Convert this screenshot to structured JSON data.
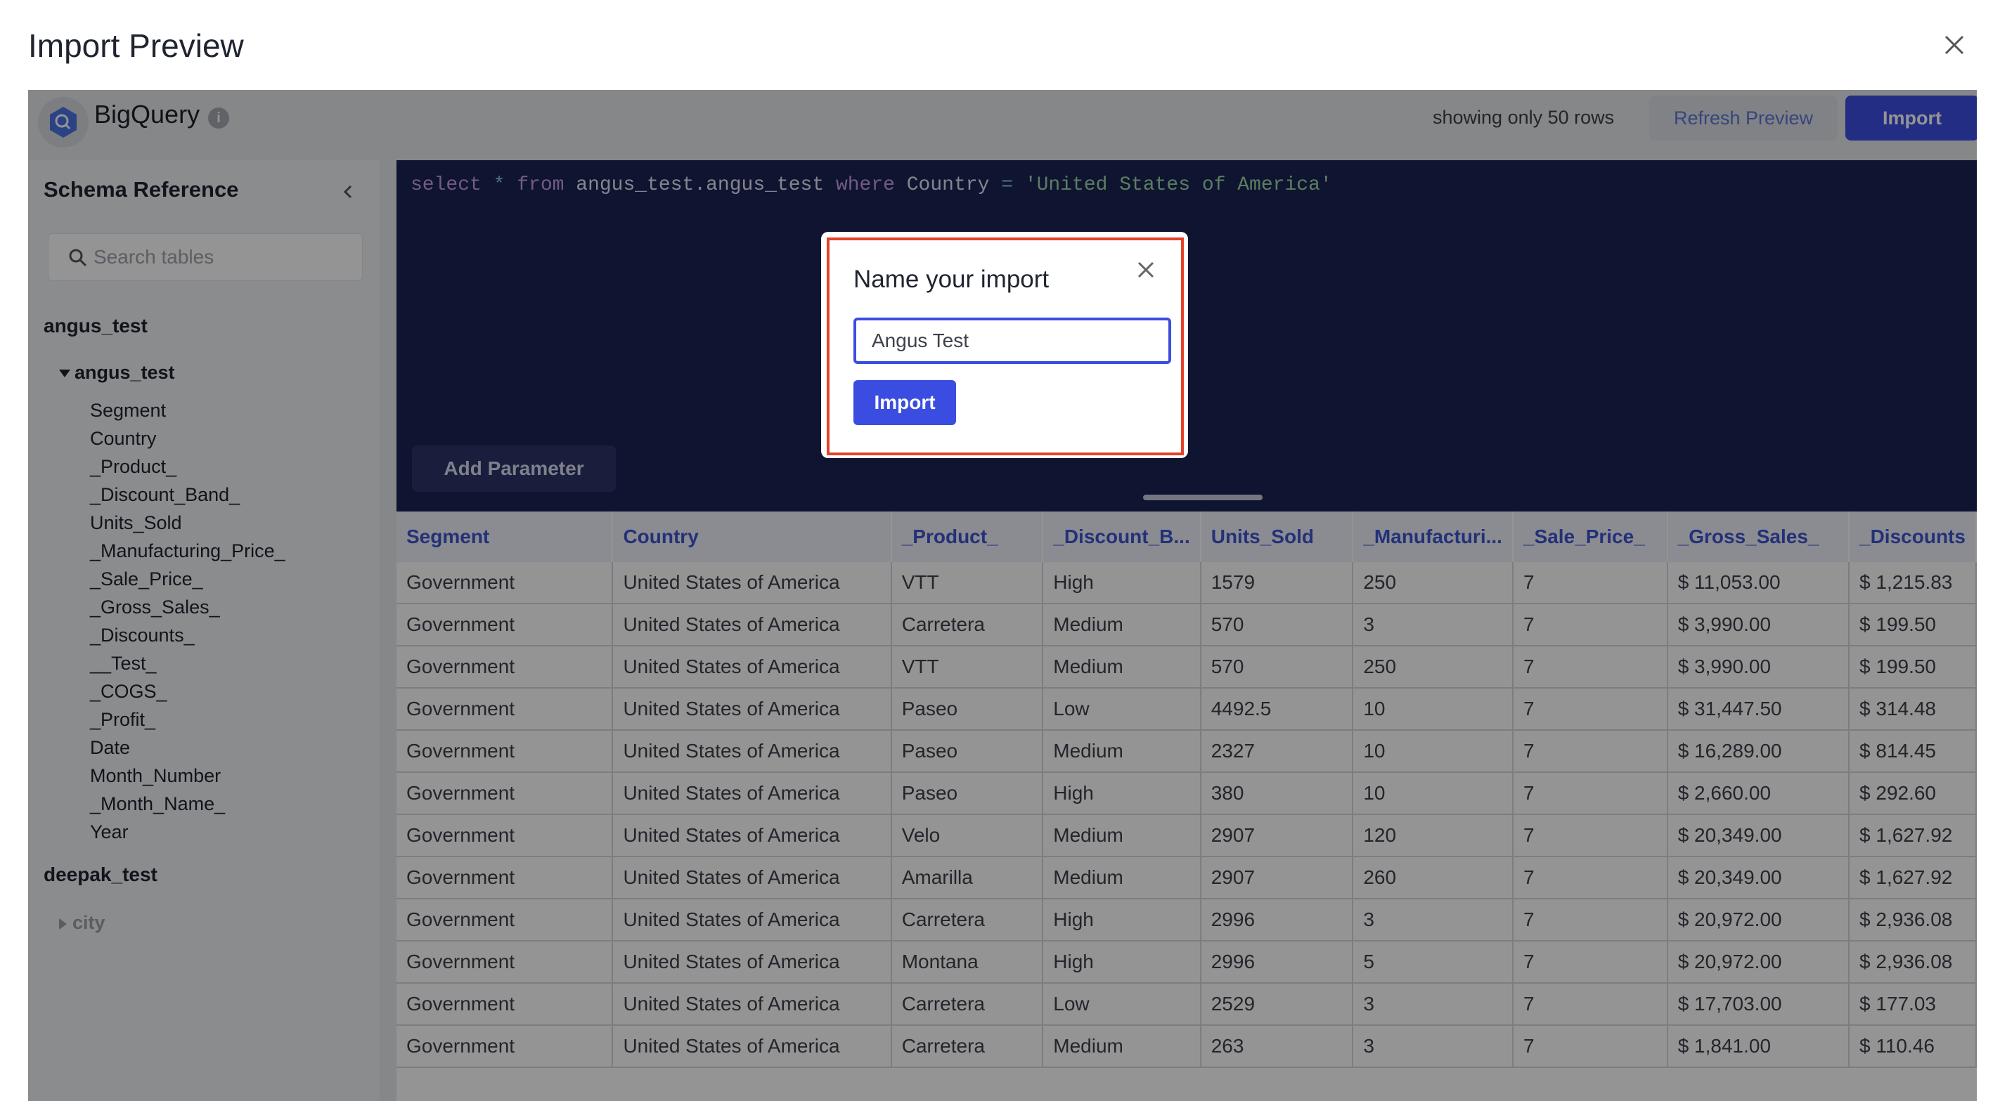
{
  "dialog": {
    "title": "Import Preview"
  },
  "toolbar": {
    "source_name": "BigQuery",
    "info_icon": "i",
    "rows_note": "showing only 50 rows",
    "refresh_label": "Refresh Preview",
    "import_label": "Import"
  },
  "sidebar": {
    "title": "Schema Reference",
    "search_placeholder": "Search tables",
    "databases": [
      {
        "name": "angus_test",
        "table": "angus_test",
        "columns": [
          "Segment",
          "Country",
          "_Product_",
          "_Discount_Band_",
          "Units_Sold",
          "_Manufacturing_Price_",
          "_Sale_Price_",
          "_Gross_Sales_",
          "_Discounts_",
          "__Test_",
          "_COGS_",
          "_Profit_",
          "Date",
          "Month_Number",
          "_Month_Name_",
          "Year"
        ]
      },
      {
        "name": "deepak_test",
        "table": "city"
      }
    ]
  },
  "editor": {
    "sql": {
      "kw1": "select",
      "star": " * ",
      "kw2": "from",
      "table": " angus_test.angus_test ",
      "kw3": "where",
      "col": " Country ",
      "eq": "=",
      "value": " 'United States of America'"
    },
    "add_parameter_label": "Add Parameter"
  },
  "table": {
    "headers": [
      "Segment",
      "Country",
      "_Product_",
      "_Discount_B...",
      "Units_Sold",
      "_Manufacturi...",
      "_Sale_Price_",
      "_Gross_Sales_",
      "_Discounts"
    ],
    "rows": [
      [
        "Government",
        "United States of America",
        "VTT",
        "High",
        "1579",
        "250",
        "7",
        "$ 11,053.00",
        "$ 1,215.83"
      ],
      [
        "Government",
        "United States of America",
        "Carretera",
        "Medium",
        "570",
        "3",
        "7",
        "$ 3,990.00",
        "$ 199.50"
      ],
      [
        "Government",
        "United States of America",
        "VTT",
        "Medium",
        "570",
        "250",
        "7",
        "$ 3,990.00",
        "$ 199.50"
      ],
      [
        "Government",
        "United States of America",
        "Paseo",
        "Low",
        "4492.5",
        "10",
        "7",
        "$ 31,447.50",
        "$ 314.48"
      ],
      [
        "Government",
        "United States of America",
        "Paseo",
        "Medium",
        "2327",
        "10",
        "7",
        "$ 16,289.00",
        "$ 814.45"
      ],
      [
        "Government",
        "United States of America",
        "Paseo",
        "High",
        "380",
        "10",
        "7",
        "$ 2,660.00",
        "$ 292.60"
      ],
      [
        "Government",
        "United States of America",
        "Velo",
        "Medium",
        "2907",
        "120",
        "7",
        "$ 20,349.00",
        "$ 1,627.92"
      ],
      [
        "Government",
        "United States of America",
        "Amarilla",
        "Medium",
        "2907",
        "260",
        "7",
        "$ 20,349.00",
        "$ 1,627.92"
      ],
      [
        "Government",
        "United States of America",
        "Carretera",
        "High",
        "2996",
        "3",
        "7",
        "$ 20,972.00",
        "$ 2,936.08"
      ],
      [
        "Government",
        "United States of America",
        "Montana",
        "High",
        "2996",
        "5",
        "7",
        "$ 20,972.00",
        "$ 2,936.08"
      ],
      [
        "Government",
        "United States of America",
        "Carretera",
        "Low",
        "2529",
        "3",
        "7",
        "$ 17,703.00",
        "$ 177.03"
      ],
      [
        "Government",
        "United States of America",
        "Carretera",
        "Medium",
        "263",
        "3",
        "7",
        "$ 1,841.00",
        "$ 110.46"
      ]
    ]
  },
  "modal": {
    "title": "Name your import",
    "input_value": "Angus Test",
    "import_label": "Import"
  },
  "colors": {
    "accent": "#3b4de0",
    "editor_bg": "#1b2354",
    "highlight": "#e4412b",
    "header_text": "#3e55cf"
  }
}
